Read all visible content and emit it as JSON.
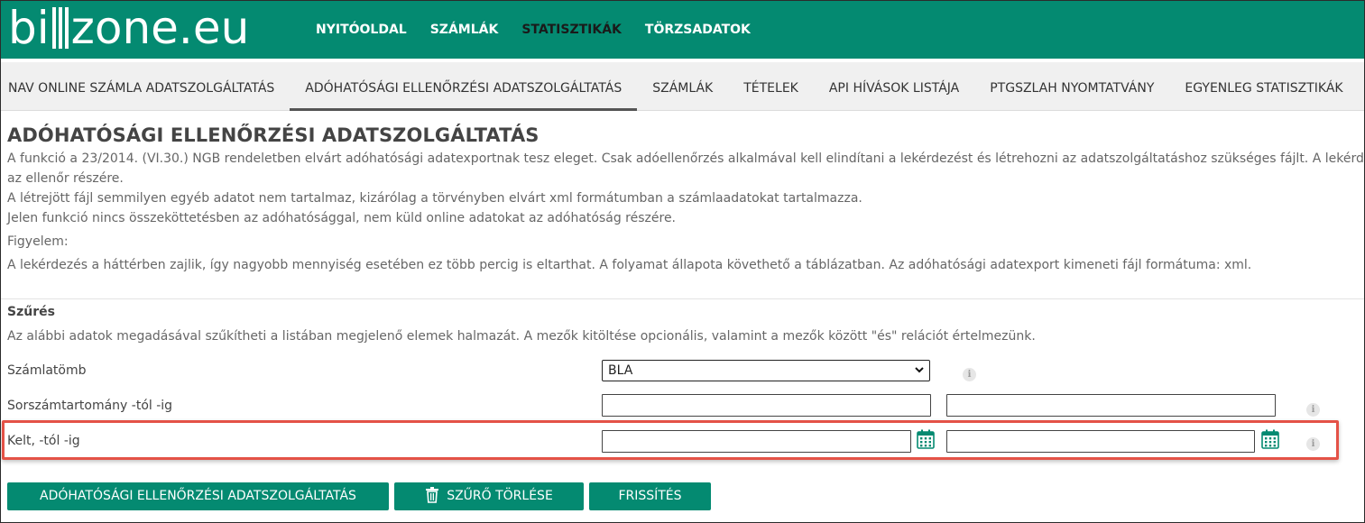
{
  "brand": {
    "logo_left": "bi",
    "logo_right": "zone.eu",
    "color": "#048a71"
  },
  "main_nav": {
    "items": [
      "NYITÓOLDAL",
      "SZÁMLÁK",
      "STATISZTIKÁK",
      "TÖRZSADATOK"
    ],
    "active": "STATISZTIKÁK"
  },
  "sub_nav": {
    "items": [
      "NAV ONLINE SZÁMLA ADATSZOLGÁLTATÁS",
      "ADÓHATÓSÁGI ELLENŐRZÉSI ADATSZOLGÁLTATÁS",
      "SZÁMLÁK",
      "TÉTELEK",
      "API HÍVÁSOK LISTÁJA",
      "PTGSZLAH NYOMTATVÁNY",
      "EGYENLEG STATISZTIKÁK"
    ],
    "active": "ADÓHATÓSÁGI ELLENŐRZÉSI ADATSZOLGÁLTATÁS"
  },
  "page": {
    "title": "ADÓHATÓSÁGI ELLENŐRZÉSI ADATSZOLGÁLTATÁS",
    "paragraphs": [
      "A funkció a 23/2014. (VI.30.) NGB rendeletben elvárt adóhatósági adatexportnak tesz eleget. Csak adóellenőrzés alkalmával kell elindítani a lekérdezést és létrehozni az adatszolgáltatáshoz szükséges fájlt. A lekérdezés",
      "az ellenőr részére.",
      "A létrejött fájl semmilyen egyéb adatot nem tartalmaz, kizárólag a törvényben elvárt xml formátumban a számlaadatokat tartalmazza.",
      "Jelen funkció nincs összeköttetésben az adóhatósággal, nem küld online adatokat az adóhatóság részére.",
      "Figyelem:",
      "A lekérdezés a háttérben zajlik, így nagyobb mennyiség esetében ez több percig is eltarthat. A folyamat állapota követhető a táblázatban. Az adóhatósági adatexport kimeneti fájl formátuma: xml."
    ]
  },
  "filter": {
    "title": "Szűrés",
    "description": "Az alábbi adatok megadásával szűkítheti a listában megjelenő elemek halmazát. A mezők kitöltése opcionális, valamint a mezők között \"és\" relációt értelmezünk.",
    "fields": {
      "invoice_block": {
        "label": "Számlatömb",
        "value": "BLA"
      },
      "serial_range": {
        "label": "Sorszámtartomány -tól -ig",
        "from": "",
        "to": ""
      },
      "issue_date": {
        "label": "Kelt, -tól -ig",
        "from": "",
        "to": ""
      }
    },
    "info_glyph": "i"
  },
  "buttons": {
    "export": "ADÓHATÓSÁGI ELLENŐRZÉSI ADATSZOLGÁLTATÁS",
    "clear_filter": "SZŰRŐ TÖRLÉSE",
    "refresh": "FRISSÍTÉS"
  },
  "icons": {
    "calendar": "calendar-icon",
    "trash": "trash-icon",
    "info": "info-icon",
    "dropdown": "chevron-down-icon"
  },
  "highlight_color": "#e45247"
}
